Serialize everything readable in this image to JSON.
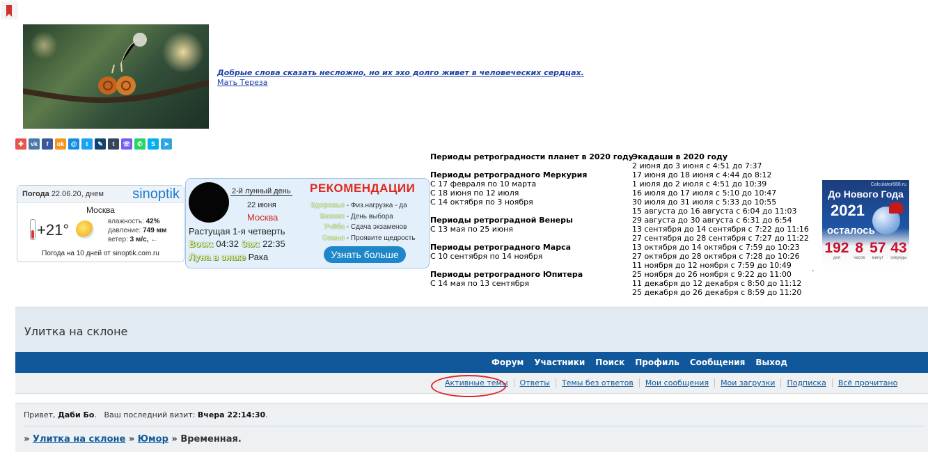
{
  "quote": {
    "text": "Добрые слова сказать несложно, но их эхо долго живет в человеческих сердцах.",
    "author": "Мать Тереза"
  },
  "share_icons": [
    {
      "name": "share-bookmark-icon",
      "glyph": "✚",
      "color": "#e8544c"
    },
    {
      "name": "vk-icon",
      "glyph": "vk",
      "color": "#4a76a8"
    },
    {
      "name": "facebook-icon",
      "glyph": "f",
      "color": "#3b5998"
    },
    {
      "name": "odnoklassniki-icon",
      "glyph": "ok",
      "color": "#f39621"
    },
    {
      "name": "moimir-icon",
      "glyph": "@",
      "color": "#168de2"
    },
    {
      "name": "twitter-icon",
      "glyph": "t",
      "color": "#1da1f2"
    },
    {
      "name": "livejournal-icon",
      "glyph": "✎",
      "color": "#124370"
    },
    {
      "name": "tumblr-icon",
      "glyph": "t",
      "color": "#35465c"
    },
    {
      "name": "viber-icon",
      "glyph": "☏",
      "color": "#7360f2"
    },
    {
      "name": "whatsapp-icon",
      "glyph": "✆",
      "color": "#25d366"
    },
    {
      "name": "skype-icon",
      "glyph": "S",
      "color": "#00aff0"
    },
    {
      "name": "telegram-icon",
      "glyph": "➤",
      "color": "#2ca5e0"
    }
  ],
  "weather": {
    "label": "Погода",
    "date": "22.06.20, днем",
    "brand": "sinoptik",
    "city": "Москва",
    "temp": "+21°",
    "humidity_label": "влажность:",
    "humidity": "42%",
    "pressure_label": "давление:",
    "pressure": "749 мм",
    "wind_label": "ветер:",
    "wind": "3 м/с,",
    "wind_dir": "←",
    "footer": "Погода на 10 дней от sinoptik.com.ru"
  },
  "moon": {
    "day": "2-й лунный день",
    "date": "22 июня",
    "city": "Москва",
    "phase": "Растущая 1-я четверть",
    "rise_label": "Восх:",
    "rise": "04:32",
    "set_label": "Зах:",
    "set": "22:35",
    "sign_label": "Луна в знаке",
    "sign": "Рака",
    "rec_title": "РЕКОМЕНДАЦИИ",
    "recs": [
      {
        "k": "Здоровье",
        "v": "- Физ.нагрузка - да"
      },
      {
        "k": "Бизнес",
        "v": "- День выбора"
      },
      {
        "k": "Учёба",
        "v": "- Сдача экзаменов"
      },
      {
        "k": "Семья",
        "v": "- Проявите щедрость"
      }
    ],
    "button": "Узнать больше"
  },
  "retro": {
    "h1": "Периоды ретроградности планет в 2020 году",
    "mercury_h": "Периоды ретроградного Меркурия",
    "mercury": [
      "С 17 февраля по 10 марта",
      "С 18 июня по 12 июля",
      "С 14 октября по 3 ноября"
    ],
    "venus_h": "Периоды ретроградной Венеры",
    "venus": [
      "С 13 мая по 25 июня"
    ],
    "mars_h": "Периоды ретроградного Марса",
    "mars": [
      "С 10 сентября по 14 ноября"
    ],
    "jupiter_h": "Периоды ретроградного Юпитера",
    "jupiter": [
      "С 14 мая по 13 сентября"
    ]
  },
  "ekadashi": {
    "title": "Экадаши в 2020 году",
    "items": [
      "2 июня до 3 июня с 4:51 до 7:37",
      "17 июня до 18 июня с 4:44 до 8:12",
      "1 июля до 2 июля с 4:51 до 10:39",
      "16 июля до 17 июля с 5:10 до 10:47",
      "30 июля до 31 июля с 5:33 до 10:55",
      "15 августа до 16 августа с 6:04 до 11:03",
      "29 августа до 30 августа с 6:31 до 6:54",
      "13 сентября до 14 сентября с 7:22 до 11:16",
      "27 сентября до 28 сентября с 7:27 до 11:22",
      "13 октября до 14 октября с 7:59 до 10:23",
      "27 октября до 28 октября с 7:28 до 10:26",
      "11 ноября до 12 ноября с 7:59 до 10:49",
      "25 ноября до 26 ноября с 9:22 до 11:00",
      "11 декабря до 12 декабря с 8:50 до 11:12",
      "25 декабря до 26 декабря с 8:59 до 11:20"
    ]
  },
  "newyear": {
    "site": "Calculator888.ru",
    "title": "До Нового Года",
    "year": "2021",
    "left": "осталось",
    "counters": [
      {
        "v": "192",
        "u": "дня"
      },
      {
        "v": "8",
        "u": "часов"
      },
      {
        "v": "57",
        "u": "минут"
      },
      {
        "v": "43",
        "u": "секунды"
      }
    ]
  },
  "forum": {
    "title": "Улитка на склоне",
    "nav": [
      "Форум",
      "Участники",
      "Поиск",
      "Профиль",
      "Сообщения",
      "Выход"
    ],
    "sub": [
      "Активные темы",
      "Ответы",
      "Темы без ответов",
      "Мои сообщения",
      "Мои загрузки",
      "Подписка",
      "Всё прочитано"
    ],
    "greet_prefix": "Привет,",
    "user": "Даби Бо",
    "visit_label": "Ваш последний визит:",
    "visit": "Вчера 22:14:30",
    "crumbs": [
      "Улитка на склоне",
      "Юмор",
      "Временная."
    ]
  }
}
